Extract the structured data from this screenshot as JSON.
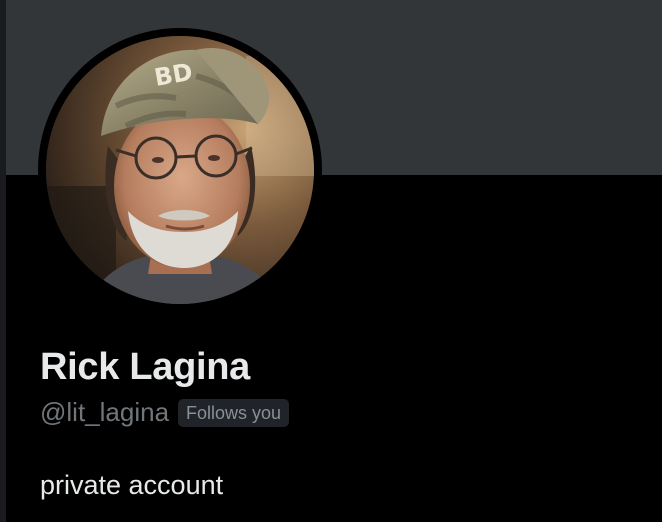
{
  "profile": {
    "display_name": "Rick Lagina",
    "handle": "@lit_lagina",
    "follows_badge": "Follows you",
    "bio": "private account",
    "avatar_alt": "Rick Lagina"
  },
  "colors": {
    "background": "#000000",
    "banner": "#333639",
    "primary_text": "#e7e9ea",
    "secondary_text": "#71767b",
    "badge_bg": "#202327"
  }
}
